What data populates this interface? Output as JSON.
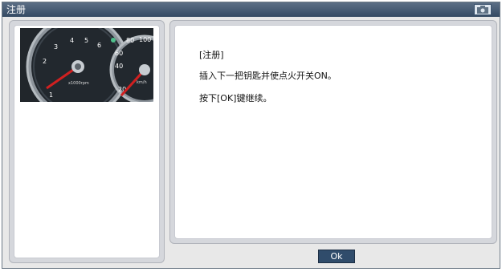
{
  "window": {
    "title": "注册",
    "camera_icon": "camera-icon"
  },
  "image": {
    "gauges": {
      "tach_labels": [
        "1",
        "2",
        "3",
        "4",
        "5",
        "6"
      ],
      "tach_unit": "x1000rpm",
      "speed_labels": [
        "20",
        "40",
        "60",
        "80",
        "100"
      ],
      "speed_unit": "km/h"
    }
  },
  "message": {
    "line1": "[注册]",
    "line2": "插入下一把钥匙并使点火开关ON。",
    "line3": "按下[OK]键继续。"
  },
  "buttons": {
    "ok_label": "Ok"
  },
  "colors": {
    "title_bar": "#344a63",
    "button": "#304c6b",
    "needle": "#d02020"
  }
}
